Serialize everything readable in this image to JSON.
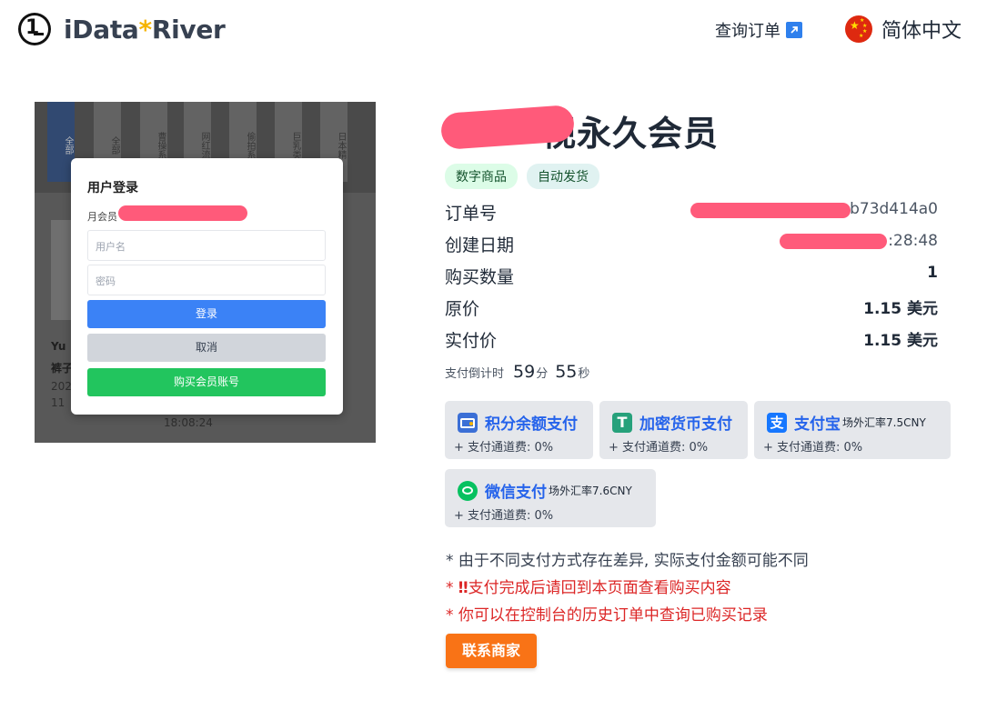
{
  "header": {
    "logo_text_a": "iData",
    "logo_text_star": "*",
    "logo_text_b": "River",
    "query_order_label": "查询订单",
    "language_label": "简体中文"
  },
  "product_image": {
    "tabs": [
      "全部",
      "全部",
      "曹操系",
      "网红流",
      "偷拍系",
      "巨乳类",
      "日本精"
    ],
    "modal_title": "用户登录",
    "modal_hint": "月会员",
    "username_placeholder": "用户名",
    "password_placeholder": "密码",
    "login_button": "登录",
    "cancel_button": "取消",
    "buy_button": "购买会员账号",
    "side_text_left": "Yu",
    "side_text_left2": "裤子",
    "date_text": "18:08:24",
    "year_text": "202",
    "num_text": "11"
  },
  "product": {
    "title_suffix": "视永久会员",
    "tags": [
      "数字商品",
      "自动发货"
    ]
  },
  "order_info": [
    {
      "key": "订单号",
      "value": "b73d414a0",
      "bold": false
    },
    {
      "key": "创建日期",
      "value": "2            :28:48",
      "bold": false
    },
    {
      "key": "购买数量",
      "value": "1",
      "bold": true
    },
    {
      "key": "原价",
      "value": "1.15 美元",
      "bold": true
    },
    {
      "key": "实付价",
      "value": "1.15 美元",
      "bold": true
    }
  ],
  "countdown": {
    "label": "支付倒计时",
    "minutes": "59",
    "minutes_unit": "分",
    "seconds": "55",
    "seconds_unit": "秒"
  },
  "payment_methods": [
    {
      "name": "积分余额支付",
      "rate": "",
      "fee": "+ 支付通道费: 0%",
      "icon": "wallet-icon",
      "color": "#3b6fd6"
    },
    {
      "name": "加密货币支付",
      "rate": "",
      "fee": "+ 支付通道费: 0%",
      "icon": "tether-icon",
      "color": "#26a17b"
    },
    {
      "name": "支付宝",
      "rate": "场外汇率7.5CNY",
      "fee": "+ 支付通道费: 0%",
      "icon": "alipay-icon",
      "color": "#1677ff"
    },
    {
      "name": "微信支付",
      "rate": "场外汇率7.6CNY",
      "fee": "+ 支付通道费: 0%",
      "icon": "wechat-icon",
      "color": "#07c160"
    }
  ],
  "notes": {
    "note1": "* 由于不同支付方式存在差异, 实际支付金额可能不同",
    "note2_prefix": "* ",
    "note2_mark": "‼",
    "note2": "支付完成后请回到本页面查看购买内容",
    "note3": "* 你可以在控制台的历史订单中查询已购买记录"
  },
  "contact_button": "联系商家"
}
